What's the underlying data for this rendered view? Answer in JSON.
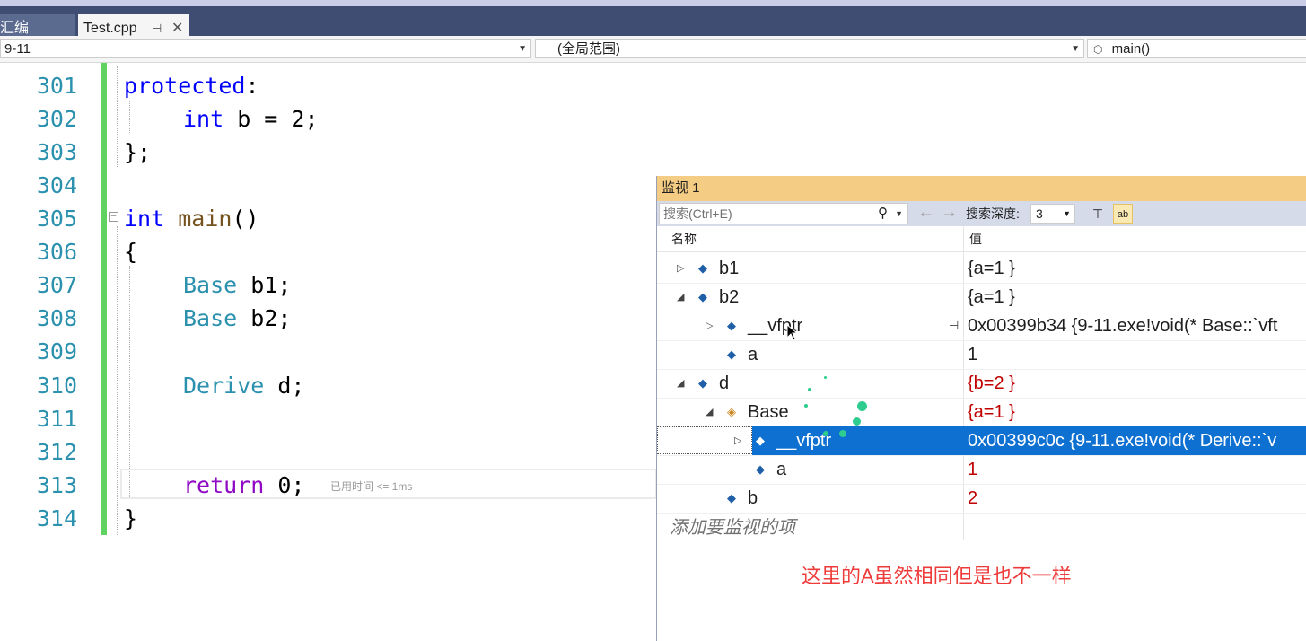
{
  "tabs": [
    {
      "label": "汇编"
    },
    {
      "label": "Test.cpp",
      "pin": "⊣",
      "close": "✕"
    }
  ],
  "navbar": {
    "project": "9-11",
    "scope": "(全局范围)",
    "member": "main()"
  },
  "code": {
    "lines": [
      {
        "num": "301",
        "text": "protected:"
      },
      {
        "num": "302",
        "text": "int b = 2;"
      },
      {
        "num": "303",
        "text": "};"
      },
      {
        "num": "304",
        "text": ""
      },
      {
        "num": "305",
        "text": "int main()"
      },
      {
        "num": "306",
        "text": "{"
      },
      {
        "num": "307",
        "text": "Base b1;"
      },
      {
        "num": "308",
        "text": "Base b2;"
      },
      {
        "num": "309",
        "text": ""
      },
      {
        "num": "310",
        "text": "Derive d;"
      },
      {
        "num": "311",
        "text": ""
      },
      {
        "num": "312",
        "text": ""
      },
      {
        "num": "313",
        "text": "return 0;"
      },
      {
        "num": "314",
        "text": "}"
      }
    ],
    "tokens": {
      "protected": "protected",
      "colon": ":",
      "int": "int",
      "b_eq": " b = 2;",
      "close_brace_semi": "};",
      "main": "main",
      "parens": "()",
      "open_brace": "{",
      "close_brace": "}",
      "base": "Base",
      "b1": " b1;",
      "b2": " b2;",
      "derive": "Derive",
      "d": " d;",
      "return": "return",
      "zero": " 0;"
    },
    "elapsed_hint": "已用时间 <= 1ms"
  },
  "watch": {
    "title": "监视 1",
    "search_placeholder": "搜索(Ctrl+E)",
    "search_depth_label": "搜索深度:",
    "search_depth_value": "3",
    "col_name": "名称",
    "col_value": "值",
    "rows": [
      {
        "name": "b1",
        "value": "{a=1 }"
      },
      {
        "name": "b2",
        "value": "{a=1 }"
      },
      {
        "name": "__vfptr",
        "value": "0x00399b34 {9-11.exe!void(* Base::`vft"
      },
      {
        "name": "a",
        "value": "1"
      },
      {
        "name": "d",
        "value": "{b=2 }"
      },
      {
        "name": "Base",
        "value": "{a=1 }"
      },
      {
        "name": "__vfptr",
        "value": "0x00399c0c {9-11.exe!void(* Derive::`v"
      },
      {
        "name": "a",
        "value": "1"
      },
      {
        "name": "b",
        "value": "2"
      }
    ],
    "add_item": "添加要监视的项"
  },
  "annotation": "这里的A虽然相同但是也不一样",
  "colors": {
    "keyword": "#0000ff",
    "type": "#2b91af",
    "control": "#8f08c4",
    "line_number": "#2b91af",
    "changed_value": "#c00000",
    "selection": "#0e70d0",
    "watch_title": "#f5cc84",
    "annotation": "#ef3a3a"
  }
}
